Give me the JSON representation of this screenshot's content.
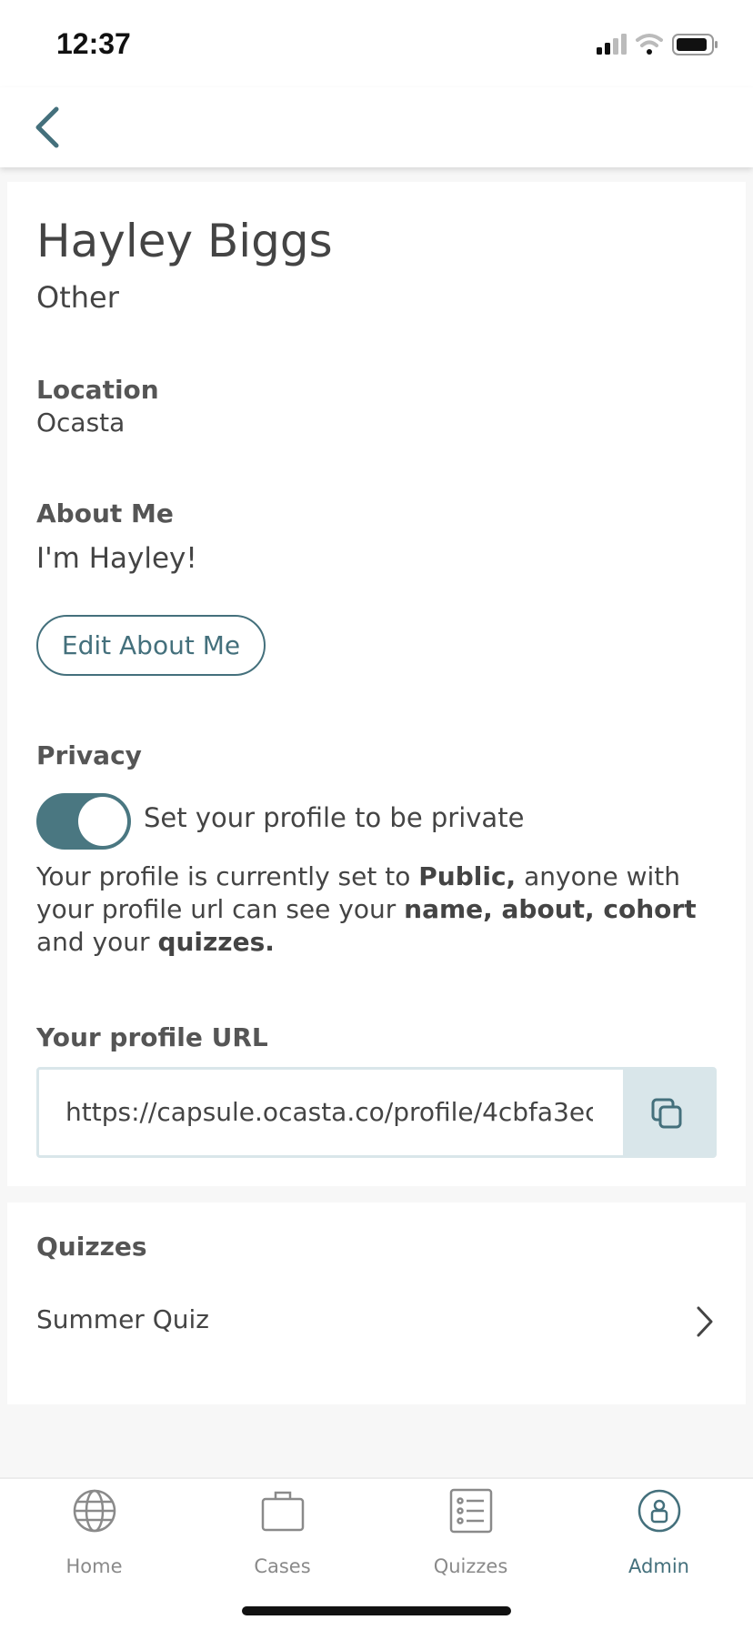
{
  "status_bar": {
    "time": "12:37"
  },
  "header": {
    "back_icon": "chevron-left-icon"
  },
  "profile": {
    "name": "Hayley Biggs",
    "role": "Other",
    "location_label": "Location",
    "location": "Ocasta",
    "about_label": "About Me",
    "about": "I'm Hayley!",
    "edit_about_button": "Edit About Me"
  },
  "privacy": {
    "label": "Privacy",
    "toggle_on": true,
    "toggle_label": "Set your profile to be private",
    "text_1": "Your profile is currently set to ",
    "text_public": "Public,",
    "text_2": " anyone with your profile url can see your ",
    "text_fields": "name, about, cohort",
    "text_3": " and your ",
    "text_quizzes": "quizzes."
  },
  "profile_url": {
    "label": "Your profile URL",
    "value": "https://capsule.ocasta.co/profile/4cbfa3ec...",
    "copy_icon": "copy-icon"
  },
  "quizzes": {
    "label": "Quizzes",
    "items": [
      {
        "title": "Summer Quiz"
      }
    ]
  },
  "tabbar": {
    "tabs": [
      {
        "label": "Home",
        "icon": "globe-icon",
        "active": false
      },
      {
        "label": "Cases",
        "icon": "briefcase-icon",
        "active": false
      },
      {
        "label": "Quizzes",
        "icon": "list-icon",
        "active": false
      },
      {
        "label": "Admin",
        "icon": "user-circle-icon",
        "active": true
      }
    ]
  },
  "colors": {
    "accent": "#44707c",
    "toggle": "#4a7781",
    "url_border": "#d9e6ea"
  }
}
